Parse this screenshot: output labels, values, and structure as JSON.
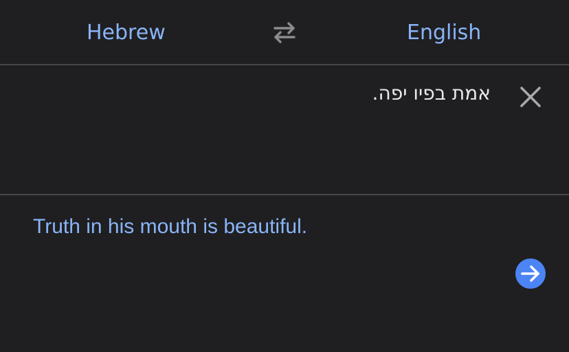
{
  "language_bar": {
    "source_language": "Hebrew",
    "target_language": "English",
    "swap_icon": "swap-arrows-icon"
  },
  "source": {
    "text": "אמת בפיו יפה.",
    "clear_icon": "close-icon"
  },
  "result": {
    "text": "Truth in his mouth is beautiful.",
    "go_icon": "arrow-right-icon"
  },
  "colors": {
    "background": "#1f1f21",
    "divider": "#46464a",
    "accent": "#8ab4f8",
    "button": "#4c84f3",
    "text": "#e8eaed"
  }
}
